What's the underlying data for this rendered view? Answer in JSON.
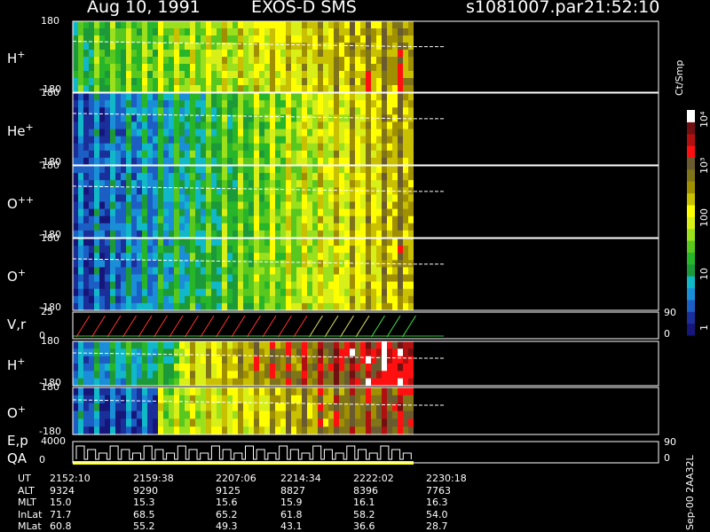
{
  "header": {
    "date": "Aug 10, 1991",
    "title": "EXOS-D SMS",
    "file": "s1081007.par",
    "time": "21:52:10"
  },
  "colorbar": {
    "unit": "Ct/Smp",
    "ticks": [
      "10⁴",
      "10³",
      "100",
      "10",
      "1"
    ]
  },
  "side_note": "Sep-00  2AA32L",
  "chart_data": {
    "type": "heatmap",
    "panels": [
      {
        "name": "H",
        "sup": "+",
        "ymin": "-180",
        "ymax": "180",
        "kind": "spectrogram",
        "trend": "increasing"
      },
      {
        "name": "He",
        "sup": "+",
        "ymin": "-180",
        "ymax": "180",
        "kind": "spectrogram",
        "trend": "increasing"
      },
      {
        "name": "O",
        "sup": "++",
        "ymin": "-180",
        "ymax": "180",
        "kind": "spectrogram",
        "trend": "increasing"
      },
      {
        "name": "O",
        "sup": "+",
        "ymin": "-180",
        "ymax": "180",
        "kind": "spectrogram",
        "trend": "increasing"
      },
      {
        "name": "V,r",
        "sup": "",
        "ymin": "0",
        "ymax": "25",
        "right_top": "90",
        "right_bottom": "0",
        "kind": "lines"
      },
      {
        "name": "H",
        "sup": "+",
        "ymin": "-180",
        "ymax": "180",
        "kind": "spectrogram",
        "trend": "peak"
      },
      {
        "name": "O",
        "sup": "+",
        "ymin": "-180",
        "ymax": "180",
        "kind": "spectrogram",
        "trend": "late"
      },
      {
        "name": "E,p",
        "sub_label": "QA",
        "ymin": "0",
        "ymax": "4000",
        "right_top": "90",
        "right_bottom": "0",
        "kind": "steps"
      }
    ],
    "data_end_time": "2230:18",
    "orbit_table": {
      "row_labels": [
        "UT",
        "ALT",
        "MLT",
        "InLat",
        "MLat"
      ],
      "columns": [
        [
          "2152:10",
          "9324",
          "15.0",
          "71.7",
          "60.8"
        ],
        [
          "2159:38",
          "9290",
          "15.3",
          "68.5",
          "55.2"
        ],
        [
          "2207:06",
          "9125",
          "15.6",
          "65.2",
          "49.3"
        ],
        [
          "2214:34",
          "8827",
          "15.9",
          "61.8",
          "43.1"
        ],
        [
          "2222:02",
          "8396",
          "16.1",
          "58.2",
          "36.6"
        ],
        [
          "2230:18",
          "7763",
          "16.3",
          "54.0",
          "28.7"
        ]
      ]
    },
    "colorscale": [
      "#16167a",
      "#1a2f9a",
      "#1c5fc4",
      "#1a8fd8",
      "#10b8c8",
      "#1c9a3a",
      "#27b52a",
      "#58c81e",
      "#9ae01c",
      "#d8f018",
      "#ffff00",
      "#c8c000",
      "#a09000",
      "#807418",
      "#6a5a30",
      "#ff1010",
      "#b01010",
      "#701010",
      "#ffffff"
    ]
  }
}
